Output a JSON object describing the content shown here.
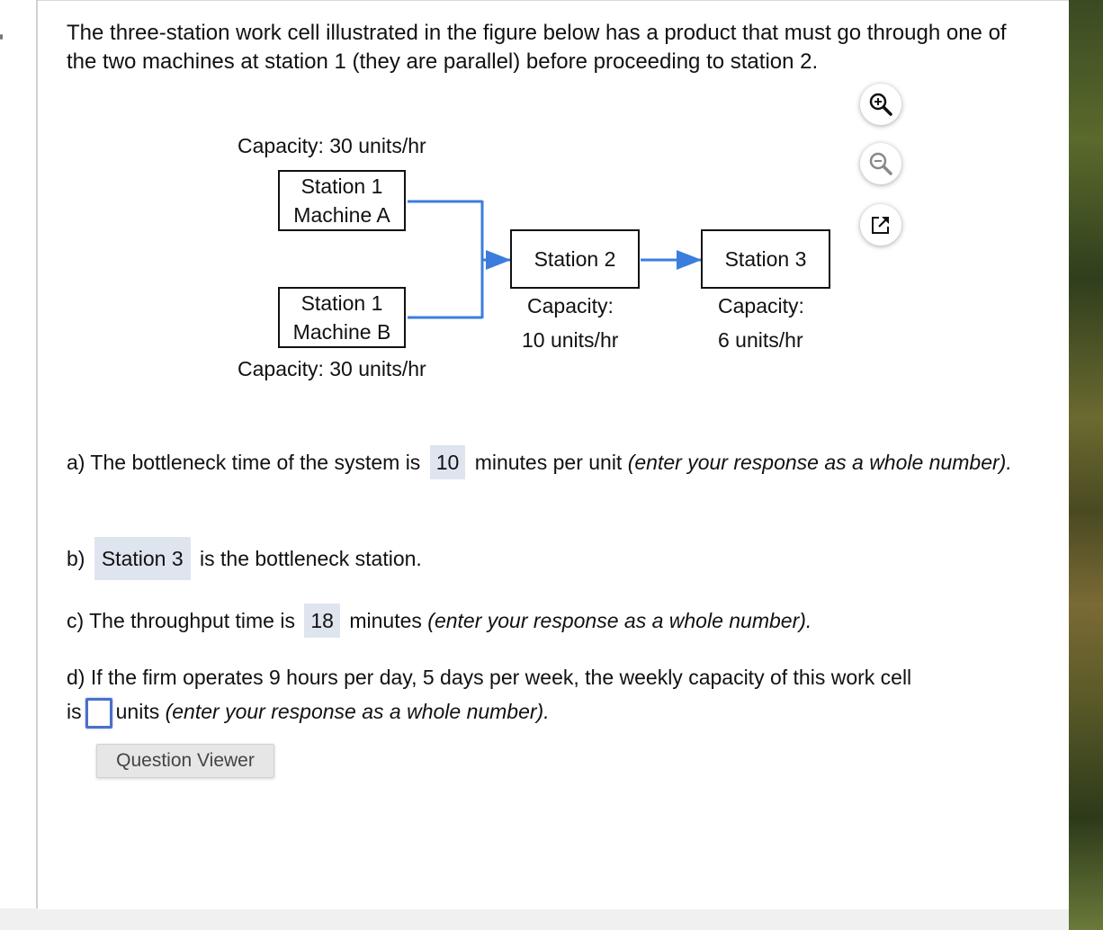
{
  "question": {
    "intro": "The three-station work cell illustrated in the figure below has a product that must go through one of the two machines at station 1 (they are parallel) before proceeding to station 2."
  },
  "toolbar": {
    "zoom_in": "zoom-in",
    "zoom_out": "zoom-out",
    "open_new_window": "open-in-new-window"
  },
  "figure": {
    "machine_a": {
      "line1": "Station 1",
      "line2": "Machine A",
      "capacity": "Capacity: 30 units/hr"
    },
    "machine_b": {
      "line1": "Station 1",
      "line2": "Machine B",
      "capacity": "Capacity: 30 units/hr"
    },
    "station2": {
      "label": "Station 2",
      "capacity_line1": "Capacity:",
      "capacity_line2": "10 units/hr"
    },
    "station3": {
      "label": "Station 3",
      "capacity_line1": "Capacity:",
      "capacity_line2": "6 units/hr"
    },
    "arrow_color": "#3b7ddd"
  },
  "parts": {
    "a": {
      "prefix": "a) The bottleneck time of the system is",
      "answer": "10",
      "suffix": "minutes per unit",
      "note": "(enter your response as a whole number)."
    },
    "b": {
      "prefix": "b)",
      "answer": "Station 3",
      "suffix": "is the bottleneck station."
    },
    "c": {
      "prefix": "c) The throughput time is",
      "answer": "18",
      "suffix": "minutes",
      "note": "(enter your response as a whole number)."
    },
    "d": {
      "line1": "d) If the firm operates 9 hours per day, 5 days per week, the weekly capacity of this work cell",
      "prefix": "is",
      "value": "",
      "suffix": "units",
      "note": "(enter your response as a whole number)."
    }
  },
  "buttons": {
    "question_viewer": "Question Viewer"
  }
}
